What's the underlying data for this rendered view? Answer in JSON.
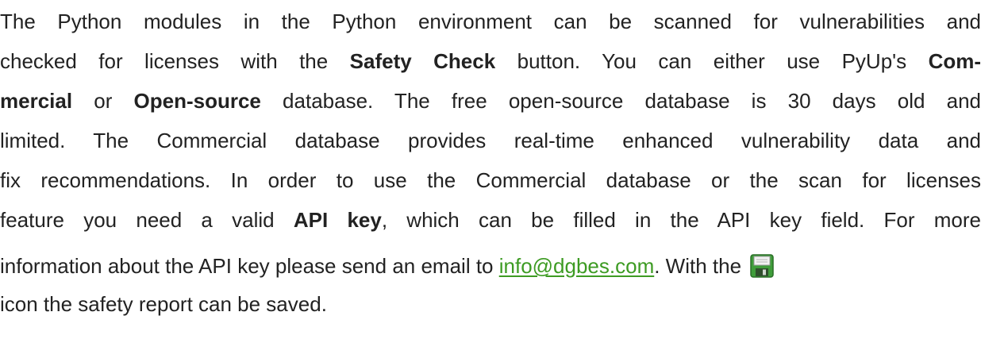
{
  "paragraph": {
    "l1": "The Python modules in the Python environment can be scanned for vulnerabilities and",
    "l2_pre": "checked for licenses with the ",
    "l2_safety_check": "Safety Check",
    "l2_mid": " button. You can either use PyUp's ",
    "l2_com": "Com-",
    "l3_mercial": "mercial",
    "l3_or": " or ",
    "l3_open_source": "Open-source",
    "l3_post": " database. The free open-source database is 30 days old and",
    "l4": "limited. The Commercial database provides real-time enhanced vulnerability data and",
    "l5": "fix recommendations. In order to use the Commercial database or the scan for licenses",
    "l6_pre": "feature you need a valid ",
    "l6_api_key": "API key",
    "l6_post": ", which can be filled in the API key field. For more",
    "l7_pre": "information about the API key please send an email to ",
    "l7_email": "info@dgbes.com",
    "l7_post": ". With the ",
    "l8": "icon the safety report can be saved."
  },
  "icons": {
    "save": "save-icon"
  },
  "colors": {
    "text": "#222222",
    "link": "#3d9b23",
    "icon_body": "#3f9d3a",
    "icon_label": "#f2f2f2"
  }
}
